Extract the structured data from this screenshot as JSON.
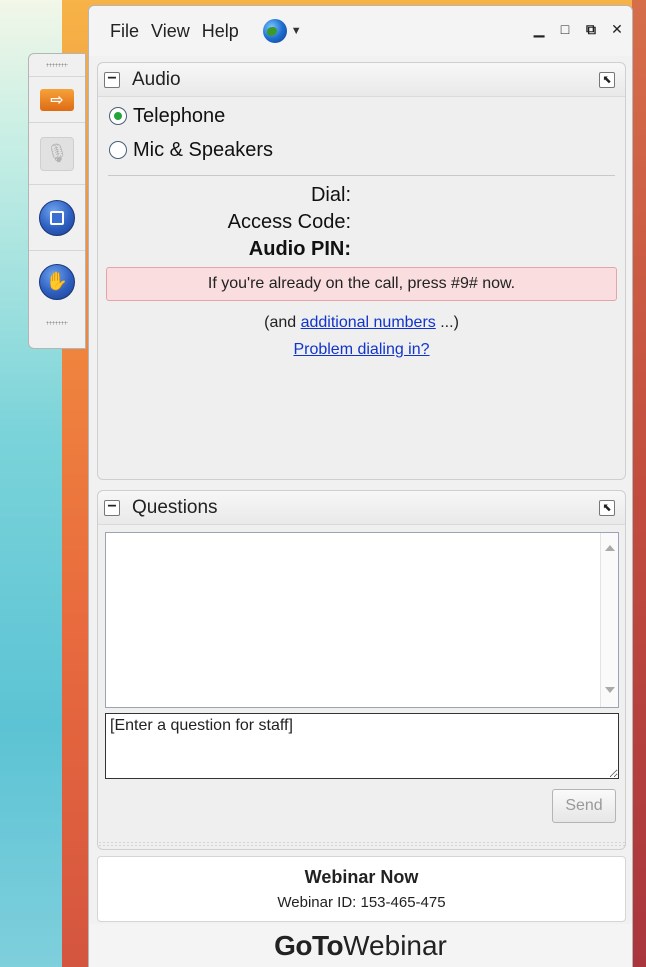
{
  "menu": {
    "file": "File",
    "view": "View",
    "help": "Help"
  },
  "window_controls": {
    "minimize": "▁",
    "maximize": "□",
    "restore": "⧉",
    "close": "✕"
  },
  "audio": {
    "title": "Audio",
    "options": [
      {
        "label": "Telephone",
        "selected": true
      },
      {
        "label": "Mic & Speakers",
        "selected": false
      }
    ],
    "dial_label": "Dial:",
    "access_code_label": "Access Code:",
    "audio_pin_label": "Audio PIN:",
    "notice": "If you're already on the call, press #9# now.",
    "more_prefix": "(and ",
    "more_link": "additional numbers",
    "more_suffix": " ...)",
    "problem_link": "Problem dialing in?"
  },
  "questions": {
    "title": "Questions",
    "input_placeholder": "[Enter a question for staff]",
    "send_label": "Send"
  },
  "webinar": {
    "title": "Webinar Now",
    "id_text": "Webinar ID: 153-465-475"
  },
  "brand": {
    "bold": "GoTo",
    "regular": "Webinar"
  },
  "icons": {
    "globe": "globe-icon",
    "collapse": "minus-icon",
    "popout": "popout-icon"
  },
  "colors": {
    "notice_bg": "#fadddf",
    "link": "#1133cc",
    "radio_selected": "#24a53b"
  }
}
